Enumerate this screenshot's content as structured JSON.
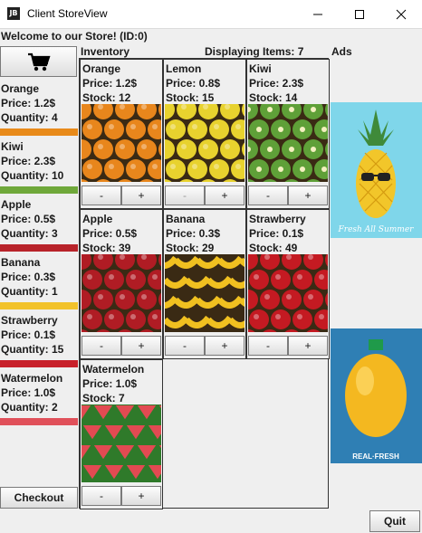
{
  "window": {
    "icon_text": "JB",
    "title": "Client StoreView",
    "minimize_icon": "minimize-icon",
    "maximize_icon": "maximize-icon",
    "close_icon": "close-icon"
  },
  "welcome": "Welcome to our Store! (ID:0)",
  "cart": {
    "icon": "shopping-cart-icon",
    "items": [
      {
        "name": "Orange",
        "price": "Price: 1.2$",
        "quantity": "Quantity: 4",
        "color": "#e88a1a"
      },
      {
        "name": "Kiwi",
        "price": "Price: 2.3$",
        "quantity": "Quantity: 10",
        "color": "#6fa83a"
      },
      {
        "name": "Apple",
        "price": "Price: 0.5$",
        "quantity": "Quantity: 3",
        "color": "#b8232a"
      },
      {
        "name": "Banana",
        "price": "Price: 0.3$",
        "quantity": "Quantity: 1",
        "color": "#f2c22a"
      },
      {
        "name": "Strawberry",
        "price": "Price: 0.1$",
        "quantity": "Quantity: 15",
        "color": "#c8202a"
      },
      {
        "name": "Watermelon",
        "price": "Price: 1.0$",
        "quantity": "Quantity: 2",
        "color": "#e0505a"
      }
    ],
    "checkout_label": "Checkout"
  },
  "inventory": {
    "title": "Inventory",
    "count_label": "Displaying Items: 7",
    "items": [
      {
        "name": "Orange",
        "price": "Price: 1.2$",
        "stock": "Stock: 12",
        "minus": "-",
        "plus": "+",
        "color": "#e8861c",
        "minus_enabled": true
      },
      {
        "name": "Lemon",
        "price": "Price: 0.8$",
        "stock": "Stock: 15",
        "minus": "-",
        "plus": "+",
        "color": "#e8d22e",
        "minus_enabled": false
      },
      {
        "name": "Kiwi",
        "price": "Price: 2.3$",
        "stock": "Stock: 14",
        "minus": "-",
        "plus": "+",
        "color": "#5fa038",
        "minus_enabled": true
      },
      {
        "name": "Apple",
        "price": "Price: 0.5$",
        "stock": "Stock: 39",
        "minus": "-",
        "plus": "+",
        "color": "#b01c24",
        "minus_enabled": true
      },
      {
        "name": "Banana",
        "price": "Price: 0.3$",
        "stock": "Stock: 29",
        "minus": "-",
        "plus": "+",
        "color": "#f0c020",
        "minus_enabled": true
      },
      {
        "name": "Strawberry",
        "price": "Price: 0.1$",
        "stock": "Stock: 49",
        "minus": "-",
        "plus": "+",
        "color": "#c41a22",
        "minus_enabled": true
      },
      {
        "name": "Watermelon",
        "price": "Price: 1.0$",
        "stock": "Stock: 7",
        "minus": "-",
        "plus": "+",
        "color": "#e24a52",
        "minus_enabled": true
      }
    ]
  },
  "ads": {
    "label": "Ads",
    "items": [
      {
        "caption": "Fresh All Summer",
        "bg": "#7fd6ea",
        "fruit": "pineapple"
      },
      {
        "caption": "REAL·FRESH",
        "bg": "#2f7fb4",
        "fruit": "orange-bottle"
      }
    ]
  },
  "quit_label": "Quit"
}
